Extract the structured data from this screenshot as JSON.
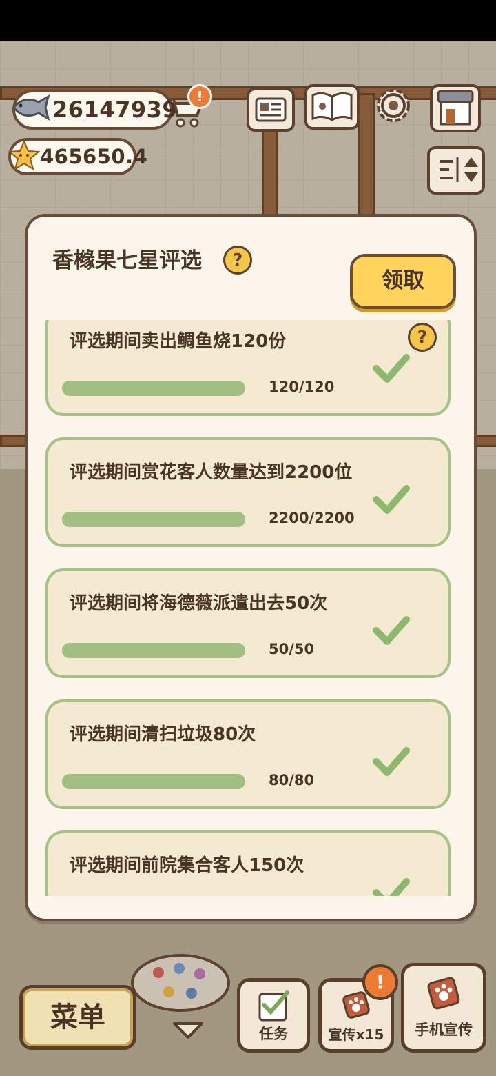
{
  "hud": {
    "fish_count": "26147939",
    "star_count": "465650.4",
    "cart_alert": "!"
  },
  "modal": {
    "title": "香橼果七星评选",
    "help_mark": "?",
    "claim_label": "领取",
    "tasks": [
      {
        "label": "评选期间卖出鲷鱼烧120份",
        "progress": "120/120",
        "completed": true,
        "has_help": true,
        "help_mark": "?",
        "fill": 1.0
      },
      {
        "label": "评选期间赏花客人数量达到2200位",
        "progress": "2200/2200",
        "completed": true,
        "fill": 1.0
      },
      {
        "label": "评选期间将海德薇派遣出去50次",
        "progress": "50/50",
        "completed": true,
        "fill": 1.0
      },
      {
        "label": "评选期间清扫垃圾80次",
        "progress": "80/80",
        "completed": true,
        "fill": 1.0
      },
      {
        "label": "评选期间前院集合客人150次",
        "progress": "",
        "completed": true,
        "fill": 1.0
      }
    ]
  },
  "bottom_bar": {
    "menu_label": "菜单",
    "tasks_label": "任务",
    "promo_label": "宣传x15",
    "promo_alert": "!",
    "phone_promo_label": "手机宣传"
  },
  "colors": {
    "accent_green": "#a2be82",
    "card_bg": "#f4ead2",
    "claim_yellow": "#ffd35c",
    "text_brown": "#4a3426",
    "alert_orange": "#ee7b34"
  }
}
